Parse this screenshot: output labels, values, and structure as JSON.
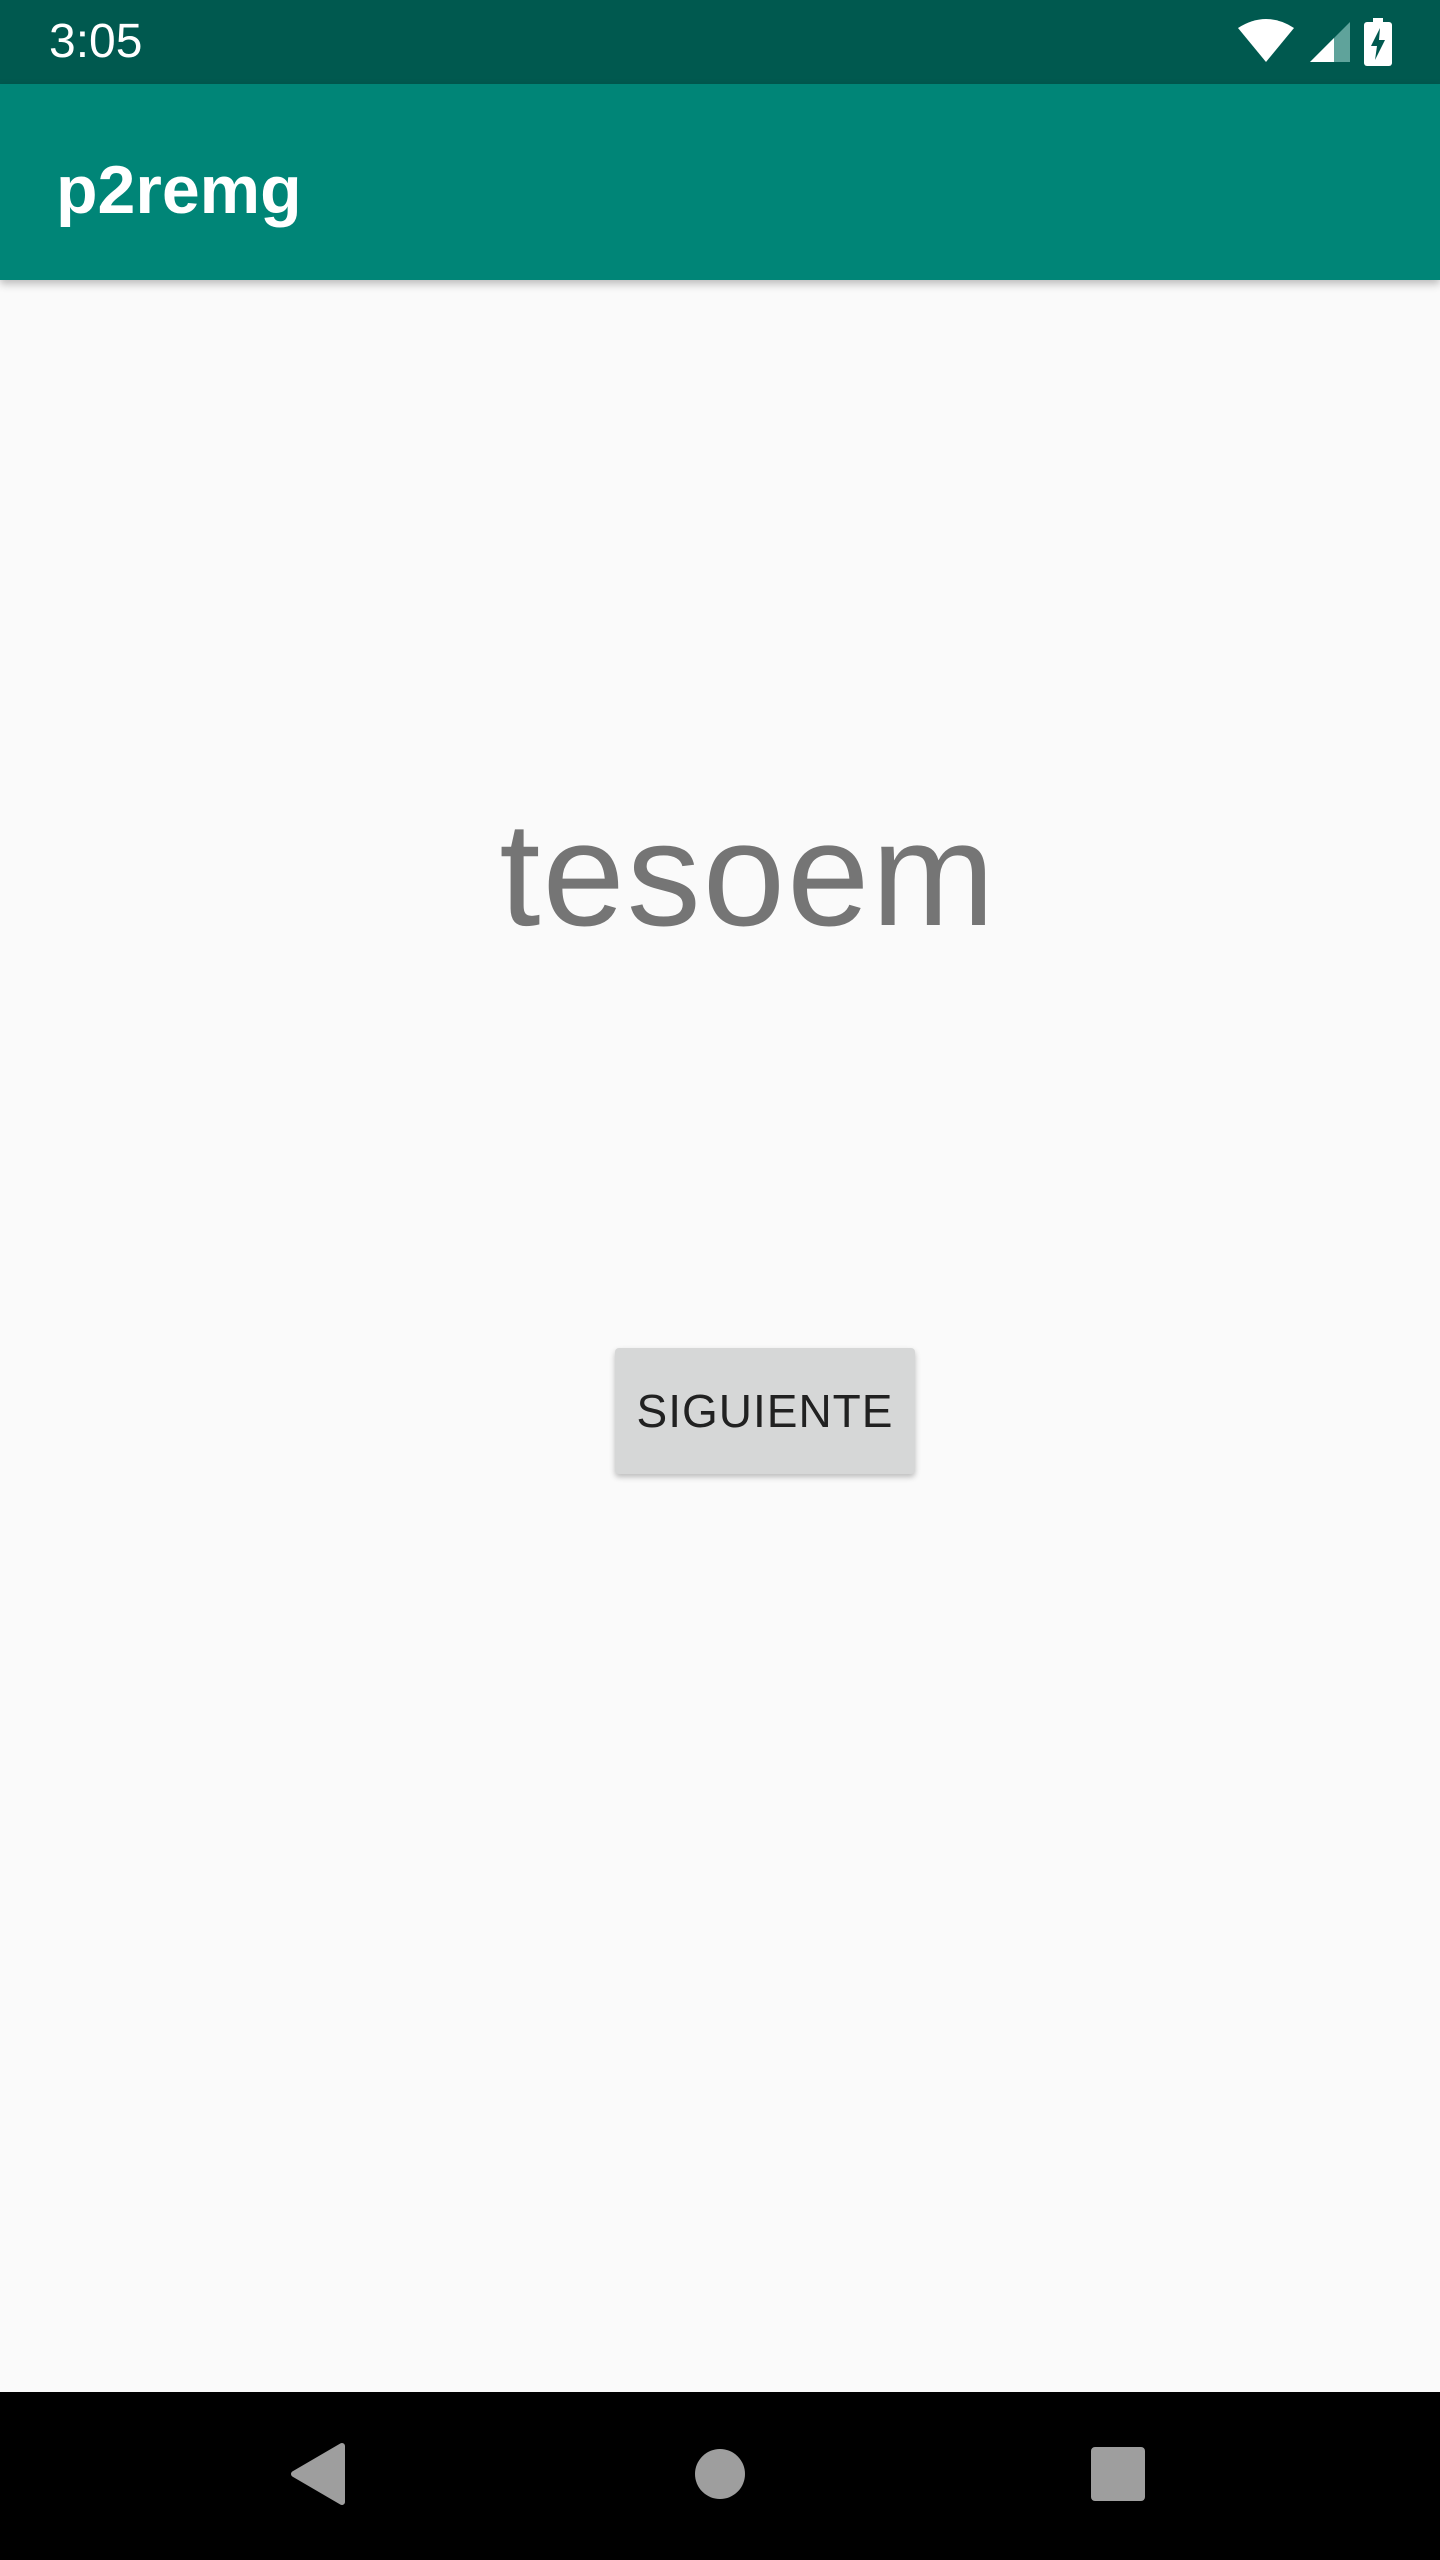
{
  "status_bar": {
    "time": "3:05",
    "icons": [
      "wifi-icon",
      "cell-signal-icon",
      "battery-charging-icon"
    ]
  },
  "app_bar": {
    "title": "p2remg"
  },
  "content": {
    "main_text": "tesoem",
    "next_button_label": "SIGUIENTE"
  },
  "nav_bar": {
    "icons": [
      "back-icon",
      "home-icon",
      "recents-icon"
    ]
  },
  "colors": {
    "status_bar": "#00594f",
    "app_bar": "#008577",
    "background": "#fafafa",
    "button": "#d6d7d7",
    "main_text": "#757575",
    "nav_bar": "#000000",
    "nav_icons": "#9e9e9e"
  }
}
